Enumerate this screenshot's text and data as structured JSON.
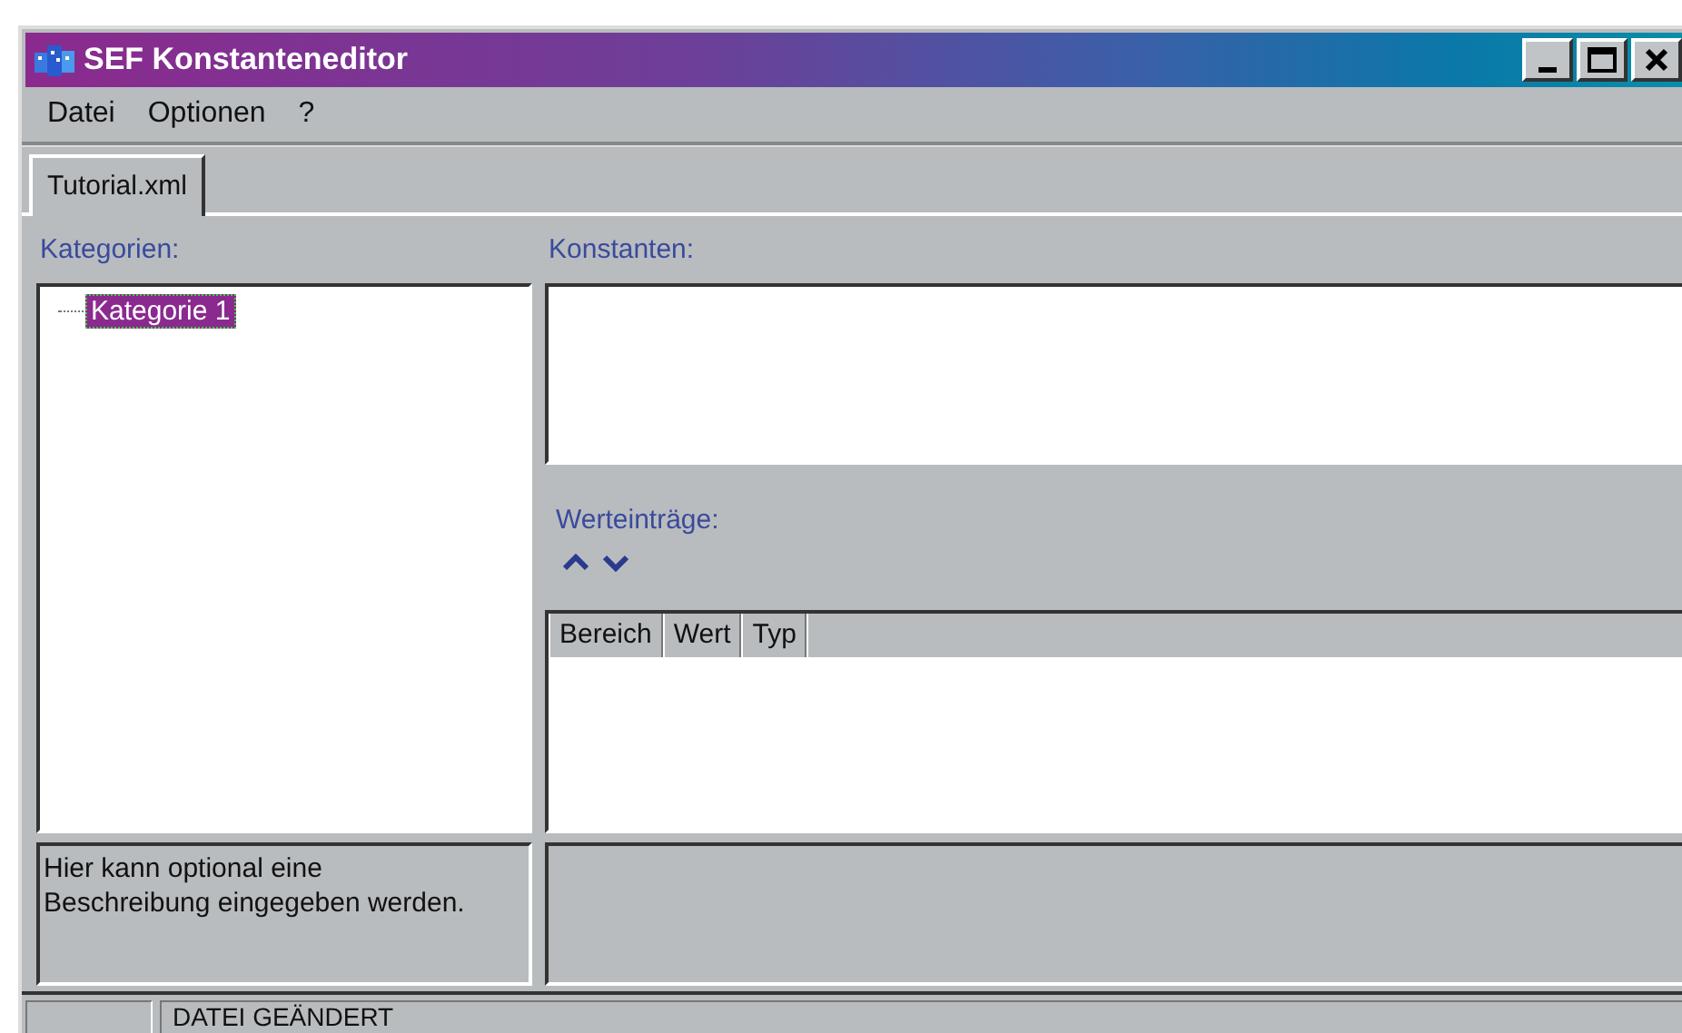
{
  "window": {
    "title": "SEF Konstanteneditor"
  },
  "menu": [
    {
      "label": "Datei"
    },
    {
      "label": "Optionen"
    },
    {
      "label": "?"
    }
  ],
  "tabs": [
    {
      "label": "Tutorial.xml",
      "selected": true
    }
  ],
  "categories": {
    "label": "Kategorien:",
    "items": [
      {
        "label": "Kategorie 1",
        "selected": true
      }
    ]
  },
  "constants": {
    "label": "Konstanten:"
  },
  "values": {
    "label": "Werteinträge:",
    "columns": [
      "Bereich",
      "Wert",
      "Typ"
    ]
  },
  "description": {
    "text": "Hier kann optional eine Beschreibung eingegeben werden."
  },
  "status_bar": {
    "text": "DATEI GEÄNDERT"
  }
}
